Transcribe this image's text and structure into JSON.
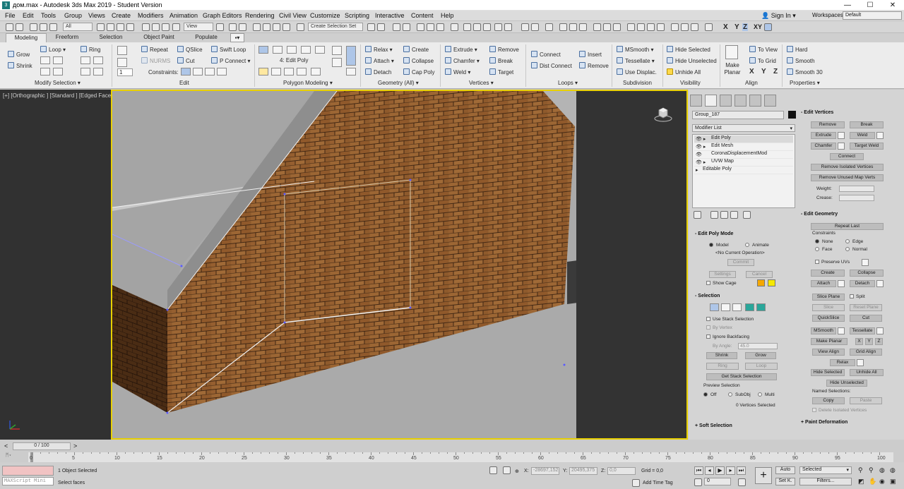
{
  "window": {
    "app_icon": "3",
    "title": "дом.max - Autodesk 3ds Max 2019 - Student Version",
    "minimize": "—",
    "maximize": "☐",
    "close": "✕"
  },
  "menu": [
    "File",
    "Edit",
    "Tools",
    "Group",
    "Views",
    "Create",
    "Modifiers",
    "Animation",
    "Graph Editors",
    "Rendering",
    "Civil View",
    "Customize",
    "Scripting",
    "Interactive",
    "Content",
    "Help"
  ],
  "account": {
    "sign_in": "Sign In",
    "workspaces_label": "Workspaces:",
    "workspace": "Default"
  },
  "toolbar": {
    "filter": "All",
    "ref_coord": "View",
    "selection_set": "Create Selection Set",
    "axis_x": "X",
    "axis_y": "Y",
    "axis_z": "Z",
    "axis_xy": "XY"
  },
  "ribbon_tabs": [
    "Modeling",
    "Freeform",
    "Selection",
    "Object Paint",
    "Populate"
  ],
  "ribbon": {
    "modify_selection": {
      "grow": "Grow",
      "shrink": "Shrink",
      "loop": "Loop",
      "ring": "Ring",
      "label": "Modify Selection"
    },
    "edit": {
      "repeat": "Repeat",
      "qslice": "QSlice",
      "swift_loop": "Swift Loop",
      "nurms": "NURMS",
      "cut": "Cut",
      "p_connect": "P Connect",
      "constraints": "Constraints:",
      "label": "Edit"
    },
    "polygon_modeling": {
      "stack_item": "4: Edit Poly",
      "spin": "1",
      "label": "Polygon Modeling"
    },
    "geometry": {
      "relax": "Relax",
      "create": "Create",
      "attach": "Attach",
      "collapse": "Collapse",
      "detach": "Detach",
      "cap_poly": "Cap Poly",
      "label": "Geometry (All)"
    },
    "vertices": {
      "extrude": "Extrude",
      "remove": "Remove",
      "chamfer": "Chamfer",
      "break": "Break",
      "weld": "Weld",
      "target": "Target",
      "label": "Vertices"
    },
    "loops": {
      "connect": "Connect",
      "insert": "Insert",
      "dist_connect": "Dist Connect",
      "remove": "Remove",
      "label": "Loops"
    },
    "subdivision": {
      "msmooth": "MSmooth",
      "tessellate": "Tessellate",
      "use_displac": "Use Displac.",
      "label": "Subdivision"
    },
    "visibility": {
      "hide_selected": "Hide Selected",
      "hide_unselected": "Hide Unselected",
      "unhide_all": "Unhide All",
      "label": "Visibility"
    },
    "align": {
      "make_planar": "Make Planar",
      "to_view": "To View",
      "to_grid": "To Grid",
      "x": "X",
      "y": "Y",
      "z": "Z",
      "label": "Align"
    },
    "properties": {
      "hard": "Hard",
      "smooth": "Smooth",
      "smooth30": "Smooth 30",
      "label": "Properties"
    }
  },
  "viewport": {
    "label": "[+] [Orthographic ] [Standard ] [Edged Faces ]",
    "brick_color": "#8a5a2e",
    "active_border": "#e8d000"
  },
  "command_panel": {
    "object_name": "Group_187",
    "modifier_list": "Modifier List",
    "stack": [
      "Edit Poly",
      "Edit Mesh",
      "CoronaDisplacementMod",
      "UVW Map",
      "Editable Poly"
    ],
    "edit_poly_mode": {
      "header": "Edit Poly Mode",
      "model": "Model",
      "animate": "Animate",
      "operation": "<No Current Operation>",
      "commit": "Commit",
      "settings": "Settings",
      "cancel": "Cancel",
      "show_cage": "Show Cage"
    },
    "selection": {
      "header": "Selection",
      "use_stack": "Use Stack Selection",
      "by_vertex": "By Vertex",
      "ignore_backfacing": "Ignore Backfacing",
      "by_angle": "By Angle:",
      "angle": "45.0",
      "shrink": "Shrink",
      "grow": "Grow",
      "ring": "Ring",
      "loop": "Loop",
      "get_stack": "Get Stack Selection",
      "preview": "Preview Selection",
      "off": "Off",
      "subobj": "SubObj",
      "multi": "Multi",
      "status": "0 Vertices Selected"
    },
    "soft_selection": "Soft Selection",
    "edit_vertices": {
      "header": "Edit Vertices",
      "remove": "Remove",
      "break": "Break",
      "extrude": "Extrude",
      "weld": "Weld",
      "chamfer": "Chamfer",
      "target_weld": "Target Weld",
      "connect": "Connect",
      "remove_isolated": "Remove Isolated Vertices",
      "remove_unused": "Remove Unused Map Verts",
      "weight": "Weight:",
      "crease": "Crease:"
    },
    "edit_geometry": {
      "header": "Edit Geometry",
      "repeat_last": "Repeat Last",
      "constraints": "Constraints",
      "none": "None",
      "edge": "Edge",
      "face": "Face",
      "normal": "Normal",
      "preserve_uvs": "Preserve UVs",
      "create": "Create",
      "collapse": "Collapse",
      "attach": "Attach",
      "detach": "Detach",
      "slice_plane": "Slice Plane",
      "split": "Split",
      "slice": "Slice",
      "reset_plane": "Reset Plane",
      "quickslice": "QuickSlice",
      "cut": "Cut",
      "msmooth": "MSmooth",
      "tessellate": "Tessellate",
      "make_planar": "Make Planar",
      "x": "X",
      "y": "Y",
      "z": "Z",
      "view_align": "View Align",
      "grid_align": "Grid Align",
      "relax": "Relax",
      "hide_selected": "Hide Selected",
      "unhide_all": "Unhide All",
      "hide_unselected": "Hide Unselected",
      "named_selections": "Named Selections:",
      "copy": "Copy",
      "paste": "Paste",
      "delete_isolated": "Delete Isolated Vertices"
    },
    "paint_deformation": "Paint Deformation"
  },
  "timeline": {
    "frame": "0 / 100",
    "ticks": [
      "0",
      "5",
      "10",
      "15",
      "20",
      "25",
      "30",
      "35",
      "40",
      "45",
      "50",
      "55",
      "60",
      "65",
      "70",
      "75",
      "80",
      "85",
      "90",
      "95",
      "100"
    ]
  },
  "status": {
    "maxscript": "MAXScript Mini",
    "objects_selected": "1 Object Selected",
    "prompt": "Select faces",
    "x_label": "X:",
    "x": "-28697,152",
    "y_label": "Y:",
    "y": "20495,375",
    "z_label": "Z:",
    "z": "0,0",
    "grid": "Grid = 0,0",
    "add_time_tag": "Add Time Tag",
    "auto": "Auto",
    "selected": "Selected",
    "set_k": "Set K.",
    "filters": "Filters...",
    "frame_spin": "0"
  }
}
